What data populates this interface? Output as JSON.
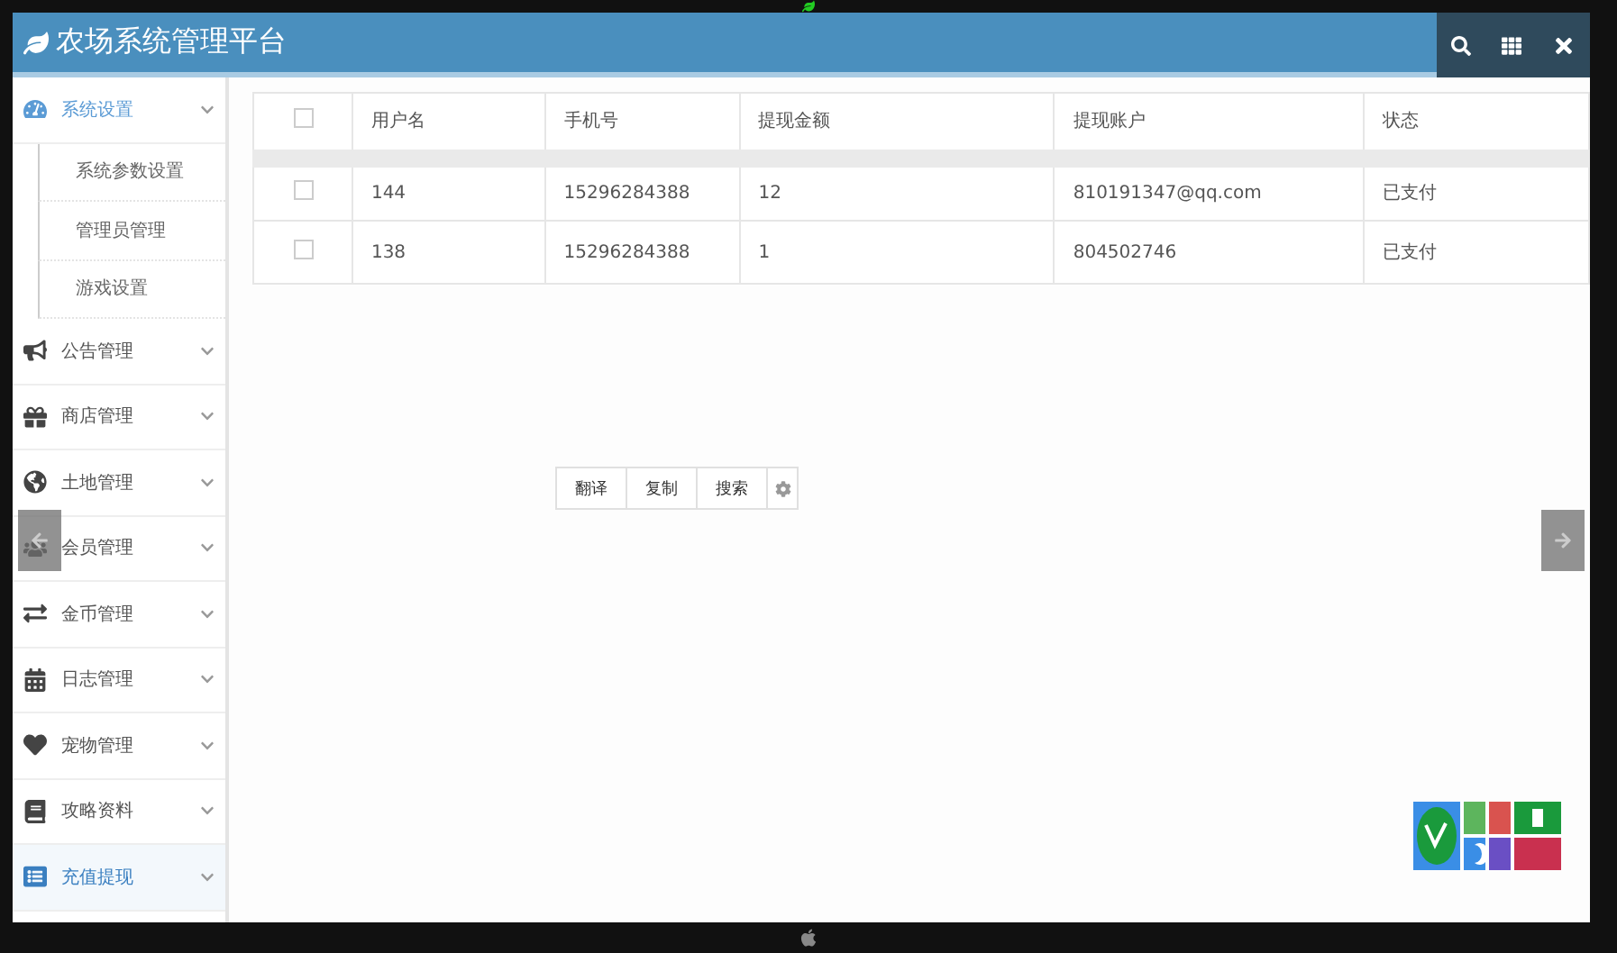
{
  "header": {
    "title": "农场系统管理平台"
  },
  "sidebar": {
    "items": [
      {
        "label": "系统设置",
        "expanded": true,
        "selected": false,
        "children": [
          {
            "label": "系统参数设置"
          },
          {
            "label": "管理员管理"
          },
          {
            "label": "游戏设置"
          }
        ]
      },
      {
        "label": "公告管理",
        "expanded": false,
        "selected": false
      },
      {
        "label": "商店管理",
        "expanded": false,
        "selected": false
      },
      {
        "label": "土地管理",
        "expanded": false,
        "selected": false
      },
      {
        "label": "会员管理",
        "expanded": false,
        "selected": false
      },
      {
        "label": "金币管理",
        "expanded": false,
        "selected": false
      },
      {
        "label": "日志管理",
        "expanded": false,
        "selected": false
      },
      {
        "label": "宠物管理",
        "expanded": false,
        "selected": false
      },
      {
        "label": "攻略资料",
        "expanded": false,
        "selected": false
      },
      {
        "label": "充值提现",
        "expanded": false,
        "selected": true
      }
    ]
  },
  "table": {
    "header_checked": false,
    "columns": [
      "用户名",
      "手机号",
      "提现金额",
      "提现账户",
      "状态"
    ],
    "rows": [
      {
        "checked": false,
        "cells": [
          "144",
          "15296284388",
          "12",
          "810191347@qq.com",
          "已支付"
        ]
      },
      {
        "checked": false,
        "cells": [
          "138",
          "15296284388",
          "1",
          "804502746",
          "已支付"
        ]
      }
    ]
  },
  "popup_toolbar": {
    "buttons": [
      "翻译",
      "复制",
      "搜索"
    ]
  }
}
